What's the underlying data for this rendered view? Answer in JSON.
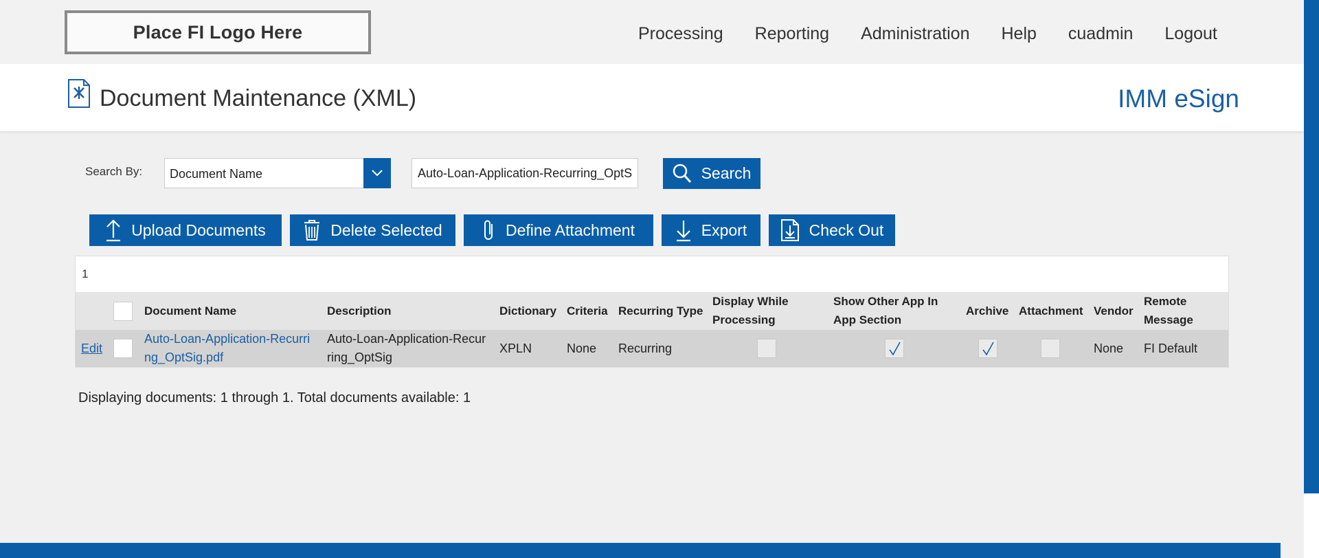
{
  "topbar": {
    "logo_text": "Place FI Logo Here",
    "nav": [
      "Processing",
      "Reporting",
      "Administration",
      "Help",
      "cuadmin",
      "Logout"
    ]
  },
  "header": {
    "title": "Document Maintenance (XML)",
    "brand": "IMM eSign"
  },
  "search": {
    "label": "Search By:",
    "field_selected": "Document Name",
    "query": "Auto-Loan-Application-Recurring_OptSig",
    "button": "Search"
  },
  "actions": {
    "upload": "Upload Documents",
    "delete": "Delete Selected",
    "define_attachment": "Define Attachment",
    "export": "Export",
    "checkout": "Check Out"
  },
  "grid": {
    "page": "1",
    "columns": {
      "doc_name": "Document Name",
      "description": "Description",
      "dictionary": "Dictionary",
      "criteria": "Criteria",
      "recurring_type": "Recurring Type",
      "display_while_1": "Display While",
      "display_while_2": "Processing",
      "show_other_1": "Show Other App In",
      "show_other_2": "App Section",
      "archive": "Archive",
      "attachment": "Attachment",
      "vendor": "Vendor",
      "remote_1": "Remote",
      "remote_2": "Message"
    },
    "rows": [
      {
        "edit": "Edit",
        "doc_name_1": "Auto-Loan-Application-Recurri",
        "doc_name_2": "ng_OptSig.pdf",
        "description_1": "Auto-Loan-Application-Recur",
        "description_2": "ring_OptSig",
        "dictionary": "XPLN",
        "criteria": "None",
        "recurring_type": "Recurring",
        "display_while_processing": false,
        "show_other_app": true,
        "archive": true,
        "attachment": false,
        "vendor": "None",
        "remote_message": "FI Default"
      }
    ]
  },
  "summary": "Displaying documents: 1 through 1. Total documents available: 1",
  "colors": {
    "primary": "#0a5ea8",
    "link": "#1a5fa5"
  }
}
